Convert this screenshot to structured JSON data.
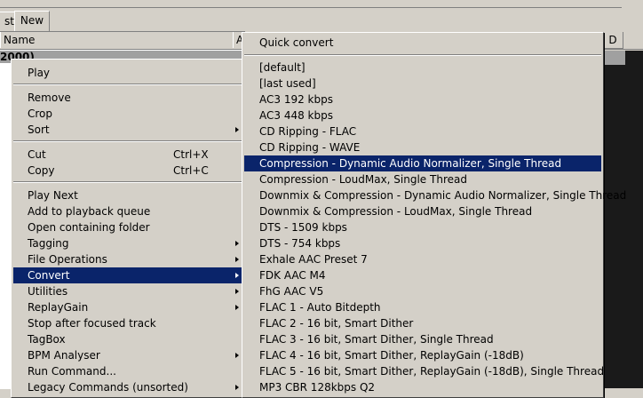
{
  "tabs": [
    {
      "label": "st"
    },
    {
      "label": "New"
    }
  ],
  "list": {
    "col_name": "Name",
    "col_a": "A",
    "group_label": "2000)"
  },
  "right_header": {
    "col_d": "D"
  },
  "context_menu": {
    "items": [
      {
        "label": "Play"
      },
      {
        "label": "Remove"
      },
      {
        "label": "Crop"
      },
      {
        "label": "Sort"
      },
      {
        "label": "Cut",
        "shortcut": "Ctrl+X"
      },
      {
        "label": "Copy",
        "shortcut": "Ctrl+C"
      },
      {
        "label": "Play Next"
      },
      {
        "label": "Add to playback queue"
      },
      {
        "label": "Open containing folder"
      },
      {
        "label": "Tagging"
      },
      {
        "label": "File Operations"
      },
      {
        "label": "Convert"
      },
      {
        "label": "Utilities"
      },
      {
        "label": "ReplayGain"
      },
      {
        "label": "Stop after focused track"
      },
      {
        "label": "TagBox"
      },
      {
        "label": "BPM Analyser"
      },
      {
        "label": "Run Command..."
      },
      {
        "label": "Legacy Commands (unsorted)"
      }
    ]
  },
  "convert_menu": {
    "items": [
      {
        "label": "Quick convert"
      },
      {
        "label": "[default]"
      },
      {
        "label": "[last used]"
      },
      {
        "label": "AC3 192 kbps"
      },
      {
        "label": "AC3 448 kbps"
      },
      {
        "label": "CD Ripping - FLAC"
      },
      {
        "label": "CD Ripping - WAVE"
      },
      {
        "label": "Compression - Dynamic Audio Normalizer, Single Thread"
      },
      {
        "label": "Compression - LoudMax, Single Thread"
      },
      {
        "label": "Downmix & Compression - Dynamic Audio Normalizer, Single Thread"
      },
      {
        "label": "Downmix & Compression - LoudMax, Single Thread"
      },
      {
        "label": "DTS - 1509 kbps"
      },
      {
        "label": "DTS - 754 kbps"
      },
      {
        "label": "Exhale AAC Preset 7"
      },
      {
        "label": "FDK AAC M4"
      },
      {
        "label": "FhG AAC V5"
      },
      {
        "label": "FLAC 1 - Auto Bitdepth"
      },
      {
        "label": "FLAC 2 - 16 bit, Smart Dither"
      },
      {
        "label": "FLAC 3 - 16 bit, Smart Dither, Single Thread"
      },
      {
        "label": "FLAC 4 - 16 bit, Smart Dither, ReplayGain (-18dB)"
      },
      {
        "label": "FLAC 5 - 16 bit, Smart Dither, ReplayGain (-18dB), Single Thread"
      },
      {
        "label": "MP3 CBR 128kbps Q2"
      }
    ]
  },
  "colors": {
    "highlight": "#0a246a",
    "menu_bg": "#d4d0c8"
  }
}
